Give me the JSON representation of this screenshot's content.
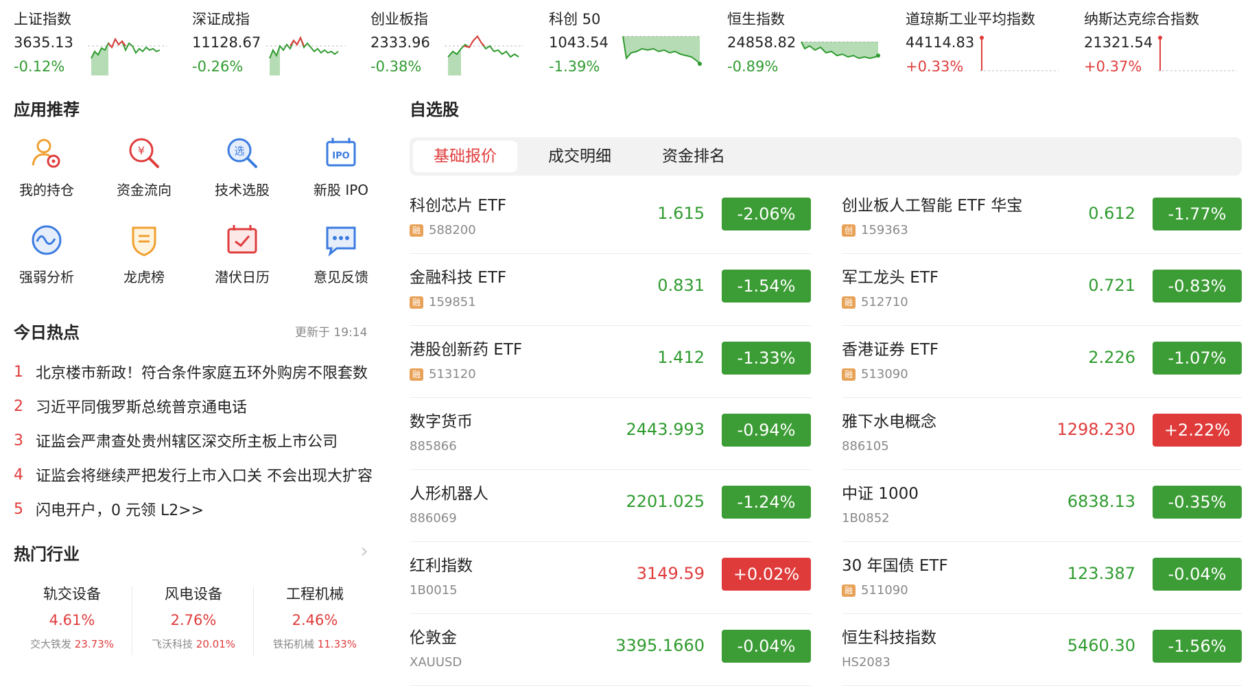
{
  "indices": [
    {
      "name": "上证指数",
      "value": "3635.13",
      "change": "-0.12%",
      "dir": "down"
    },
    {
      "name": "深证成指",
      "value": "11128.67",
      "change": "-0.26%",
      "dir": "down"
    },
    {
      "name": "创业板指",
      "value": "2333.96",
      "change": "-0.38%",
      "dir": "down"
    },
    {
      "name": "科创 50",
      "value": "1043.54",
      "change": "-1.39%",
      "dir": "down"
    },
    {
      "name": "恒生指数",
      "value": "24858.82",
      "change": "-0.89%",
      "dir": "down"
    },
    {
      "name": "道琼斯工业平均指数",
      "value": "44114.83",
      "change": "+0.33%",
      "dir": "up"
    },
    {
      "name": "纳斯达克综合指数",
      "value": "21321.54",
      "change": "+0.37%",
      "dir": "up"
    }
  ],
  "apps": {
    "title": "应用推荐",
    "items": [
      {
        "label": "我的持仓",
        "icon": "person-holding-icon"
      },
      {
        "label": "资金流向",
        "icon": "money-search-icon"
      },
      {
        "label": "技术选股",
        "icon": "stock-pick-icon"
      },
      {
        "label": "新股 IPO",
        "icon": "ipo-calendar-icon"
      },
      {
        "label": "强弱分析",
        "icon": "wave-analysis-icon"
      },
      {
        "label": "龙虎榜",
        "icon": "shield-badge-icon"
      },
      {
        "label": "潜伏日历",
        "icon": "calendar-check-icon"
      },
      {
        "label": "意见反馈",
        "icon": "chat-bubble-icon"
      }
    ]
  },
  "hot": {
    "title": "今日热点",
    "updated": "更新于 19:14",
    "items": [
      {
        "num": "1",
        "text": "北京楼市新政！符合条件家庭五环外购房不限套数"
      },
      {
        "num": "2",
        "text": "习近平同俄罗斯总统普京通电话"
      },
      {
        "num": "3",
        "text": "证监会严肃查处贵州辖区深交所主板上市公司"
      },
      {
        "num": "4",
        "text": "证监会将继续严把发行上市入口关 不会出现大扩容"
      },
      {
        "num": "5",
        "text": "闪电开户，0 元领 L2>>"
      }
    ]
  },
  "industry": {
    "title": "热门行业",
    "items": [
      {
        "name": "轨交设备",
        "pct": "4.61%",
        "leader": "交大铁发",
        "leader_pct": "23.73%"
      },
      {
        "name": "风电设备",
        "pct": "2.76%",
        "leader": "飞沃科技",
        "leader_pct": "20.01%"
      },
      {
        "name": "工程机械",
        "pct": "2.46%",
        "leader": "铁拓机械",
        "leader_pct": "11.33%"
      }
    ]
  },
  "watchlist": {
    "title": "自选股",
    "tabs": [
      "基础报价",
      "成交明细",
      "资金排名"
    ],
    "active_tab": 0,
    "left": [
      {
        "name": "科创芯片 ETF",
        "code": "588200",
        "badge": "融",
        "price": "1.615",
        "change": "-2.06%",
        "dir": "down"
      },
      {
        "name": "金融科技 ETF",
        "code": "159851",
        "badge": "融",
        "price": "0.831",
        "change": "-1.54%",
        "dir": "down"
      },
      {
        "name": "港股创新药 ETF",
        "code": "513120",
        "badge": "融",
        "price": "1.412",
        "change": "-1.33%",
        "dir": "down"
      },
      {
        "name": "数字货币",
        "code": "885866",
        "badge": "",
        "price": "2443.993",
        "change": "-0.94%",
        "dir": "down"
      },
      {
        "name": "人形机器人",
        "code": "886069",
        "badge": "",
        "price": "2201.025",
        "change": "-1.24%",
        "dir": "down"
      },
      {
        "name": "红利指数",
        "code": "1B0015",
        "badge": "",
        "price": "3149.59",
        "change": "+0.02%",
        "dir": "up"
      },
      {
        "name": "伦敦金",
        "code": "XAUUSD",
        "badge": "",
        "price": "3395.1660",
        "change": "-0.04%",
        "dir": "down"
      }
    ],
    "right": [
      {
        "name": "创业板人工智能 ETF 华宝",
        "code": "159363",
        "badge": "创",
        "price": "0.612",
        "change": "-1.77%",
        "dir": "down"
      },
      {
        "name": "军工龙头 ETF",
        "code": "512710",
        "badge": "融",
        "price": "0.721",
        "change": "-0.83%",
        "dir": "down"
      },
      {
        "name": "香港证券 ETF",
        "code": "513090",
        "badge": "融",
        "price": "2.226",
        "change": "-1.07%",
        "dir": "down"
      },
      {
        "name": "雅下水电概念",
        "code": "886105",
        "badge": "",
        "price": "1298.230",
        "change": "+2.22%",
        "dir": "up"
      },
      {
        "name": "中证 1000",
        "code": "1B0852",
        "badge": "",
        "price": "6838.13",
        "change": "-0.35%",
        "dir": "down"
      },
      {
        "name": "30 年国债 ETF",
        "code": "511090",
        "badge": "融",
        "price": "123.387",
        "change": "-0.04%",
        "dir": "down"
      },
      {
        "name": "恒生科技指数",
        "code": "HS2083",
        "badge": "",
        "price": "5460.30",
        "change": "-1.56%",
        "dir": "down"
      }
    ]
  },
  "colors": {
    "up": "#e03b3b",
    "down": "#2f9b2f",
    "badge": "#e8a258",
    "accent": "#e03b3b"
  }
}
